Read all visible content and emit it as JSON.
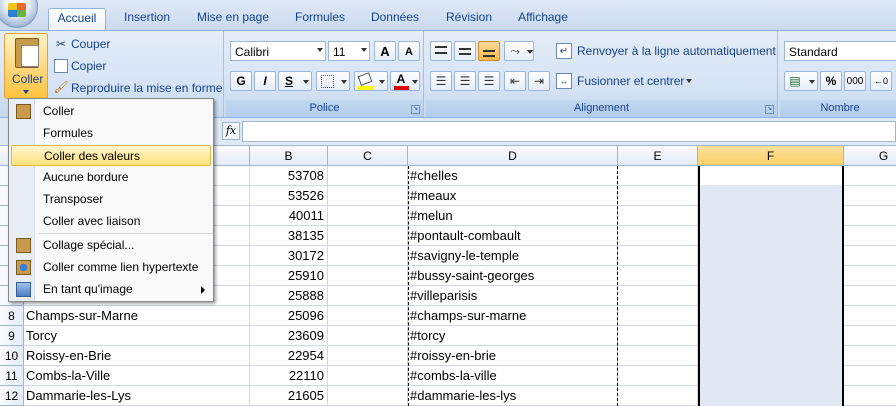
{
  "tabs": [
    {
      "label": "Accueil",
      "active": true
    },
    {
      "label": "Insertion"
    },
    {
      "label": "Mise en page"
    },
    {
      "label": "Formules"
    },
    {
      "label": "Données"
    },
    {
      "label": "Révision"
    },
    {
      "label": "Affichage"
    }
  ],
  "clipboard": {
    "paste_label": "Coller",
    "cut_label": "Couper",
    "copy_label": "Copier",
    "format_painter_label": "Reproduire la mise en forme"
  },
  "font": {
    "group_label": "Police",
    "name": "Calibri",
    "size": "11",
    "grow_label": "A",
    "shrink_label": "A",
    "bold": "G",
    "italic": "I",
    "underline": "S",
    "font_color_letter": "A"
  },
  "alignment": {
    "group_label": "Alignement",
    "wrap_label": "Renvoyer à la ligne automatiquement",
    "merge_label": "Fusionner et centrer"
  },
  "number": {
    "group_label": "Nombre",
    "format": "Standard",
    "percent": "%",
    "thousands": "000"
  },
  "formula_bar": {
    "fx": "fx",
    "value": ""
  },
  "columns": [
    "B",
    "C",
    "D",
    "E",
    "F",
    "G"
  ],
  "rows": [
    {
      "n": "",
      "a": "",
      "b": "53708",
      "d": "#chelles"
    },
    {
      "n": "",
      "a": "",
      "b": "53526",
      "d": "#meaux"
    },
    {
      "n": "",
      "a": "",
      "b": "40011",
      "d": "#melun"
    },
    {
      "n": "",
      "a": "",
      "b": "38135",
      "d": "#pontault-combault"
    },
    {
      "n": "",
      "a": "",
      "b": "30172",
      "d": "#savigny-le-temple"
    },
    {
      "n": "",
      "a": "",
      "b": "25910",
      "d": "#bussy-saint-georges"
    },
    {
      "n": "",
      "a": "",
      "b": "25888",
      "d": "#villeparisis"
    },
    {
      "n": "8",
      "a": "Champs-sur-Marne",
      "b": "25096",
      "d": "#champs-sur-marne"
    },
    {
      "n": "9",
      "a": "Torcy",
      "b": "23609",
      "d": "#torcy"
    },
    {
      "n": "10",
      "a": "Roissy-en-Brie",
      "b": "22954",
      "d": "#roissy-en-brie"
    },
    {
      "n": "11",
      "a": "Combs-la-Ville",
      "b": "22110",
      "d": "#combs-la-ville"
    },
    {
      "n": "12",
      "a": "Dammarie-les-Lys",
      "b": "21605",
      "d": "#dammarie-les-lys"
    }
  ],
  "paste_menu": [
    {
      "label": "Coller",
      "icon": "clipboard-icon"
    },
    {
      "label": "Formules"
    },
    {
      "label": "Coller des valeurs",
      "highlighted": true
    },
    {
      "label": "Aucune bordure"
    },
    {
      "label": "Transposer"
    },
    {
      "label": "Coller avec liaison"
    },
    {
      "label": "Collage spécial...",
      "icon": "clipboard-icon"
    },
    {
      "label": "Coller comme lien hypertexte",
      "icon": "hyperlink-icon"
    },
    {
      "label": "En tant qu'image",
      "icon": "picture-icon",
      "submenu": true
    }
  ]
}
